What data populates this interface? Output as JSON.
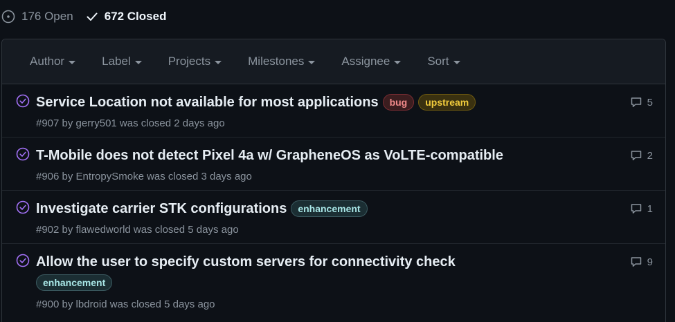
{
  "states": {
    "open_label": "176 Open",
    "closed_label": "672 Closed"
  },
  "filters": [
    "Author",
    "Label",
    "Projects",
    "Milestones",
    "Assignee",
    "Sort"
  ],
  "colors": {
    "closed_icon": "#a371f7",
    "background": "#0d1117",
    "header_background": "#161b22"
  },
  "issues": [
    {
      "title": "Service Location not available for most applications",
      "labels": [
        "bug",
        "upstream"
      ],
      "meta": "#907 by gerry501 was closed 2 days ago",
      "comments": "5"
    },
    {
      "title": "T-Mobile does not detect Pixel 4a w/ GrapheneOS as VoLTE-compatible",
      "labels": [],
      "meta": "#906 by EntropySmoke was closed 3 days ago",
      "comments": "2"
    },
    {
      "title": "Investigate carrier STK configurations",
      "labels": [
        "enhancement"
      ],
      "meta": "#902 by flawedworld was closed 5 days ago",
      "comments": "1"
    },
    {
      "title": "Allow the user to specify custom servers for connectivity check",
      "labels": [
        "enhancement"
      ],
      "meta": "#900 by lbdroid was closed 5 days ago",
      "comments": "9"
    }
  ],
  "icons": {
    "open": "issue-opened-icon",
    "closed": "check-icon",
    "issue_status": "issue-closed-icon",
    "comments": "comment-icon",
    "dropdown": "caret-down-icon"
  }
}
